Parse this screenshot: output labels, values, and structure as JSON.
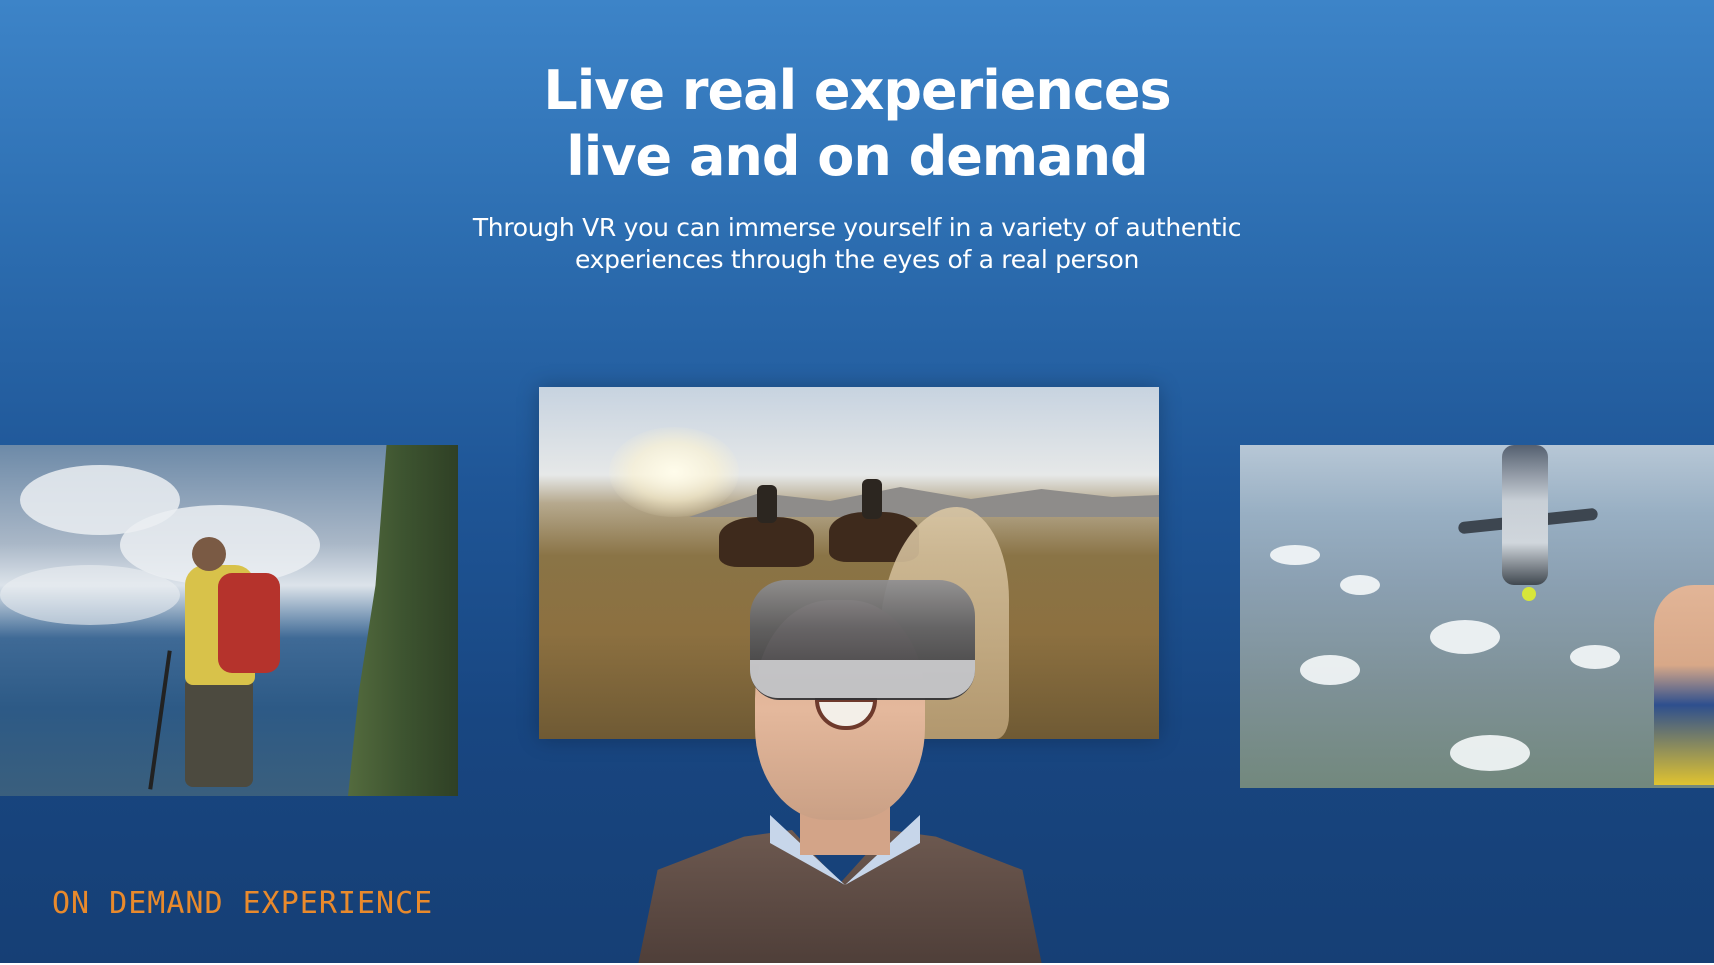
{
  "hero": {
    "title_line_1": "Live real experiences",
    "title_line_2": "live and on demand",
    "subtitle_line_1": "Through VR you can immerse yourself in a variety of authentic",
    "subtitle_line_2": "experiences through the eyes of a real person"
  },
  "section_label": "ON DEMAND EXPERIENCE",
  "colors": {
    "background_top": "#3d84c8",
    "background_bottom": "#163f75",
    "title_text": "#ffffff",
    "label_text": "#e98a2c"
  }
}
